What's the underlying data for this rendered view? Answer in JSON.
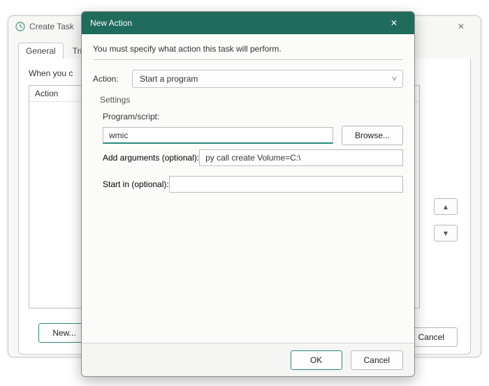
{
  "parent": {
    "title": "Create Task",
    "whenLabel": "When you c",
    "tabs": {
      "general": "General",
      "triggers": "Triq"
    },
    "listHeader": "Action",
    "newBtn": "New...",
    "upGlyph": "▴",
    "downGlyph": "▾",
    "cancelBtn": "Cancel",
    "closeGlyph": "✕"
  },
  "modal": {
    "title": "New Action",
    "closeGlyph": "✕",
    "intro": "You must specify what action this task will perform.",
    "actionLabel": "Action:",
    "actionSelected": "Start a program",
    "caret": "˅",
    "settingsLabel": "Settings",
    "programLabel": "Program/script:",
    "programValue": "wmic",
    "browseBtn": "Browse...",
    "argsLabel": "Add arguments (optional):",
    "argsValue": "py call create Volume=C:\\",
    "startInLabel": "Start in (optional):",
    "startInValue": "",
    "okBtn": "OK",
    "cancelBtn": "Cancel"
  }
}
